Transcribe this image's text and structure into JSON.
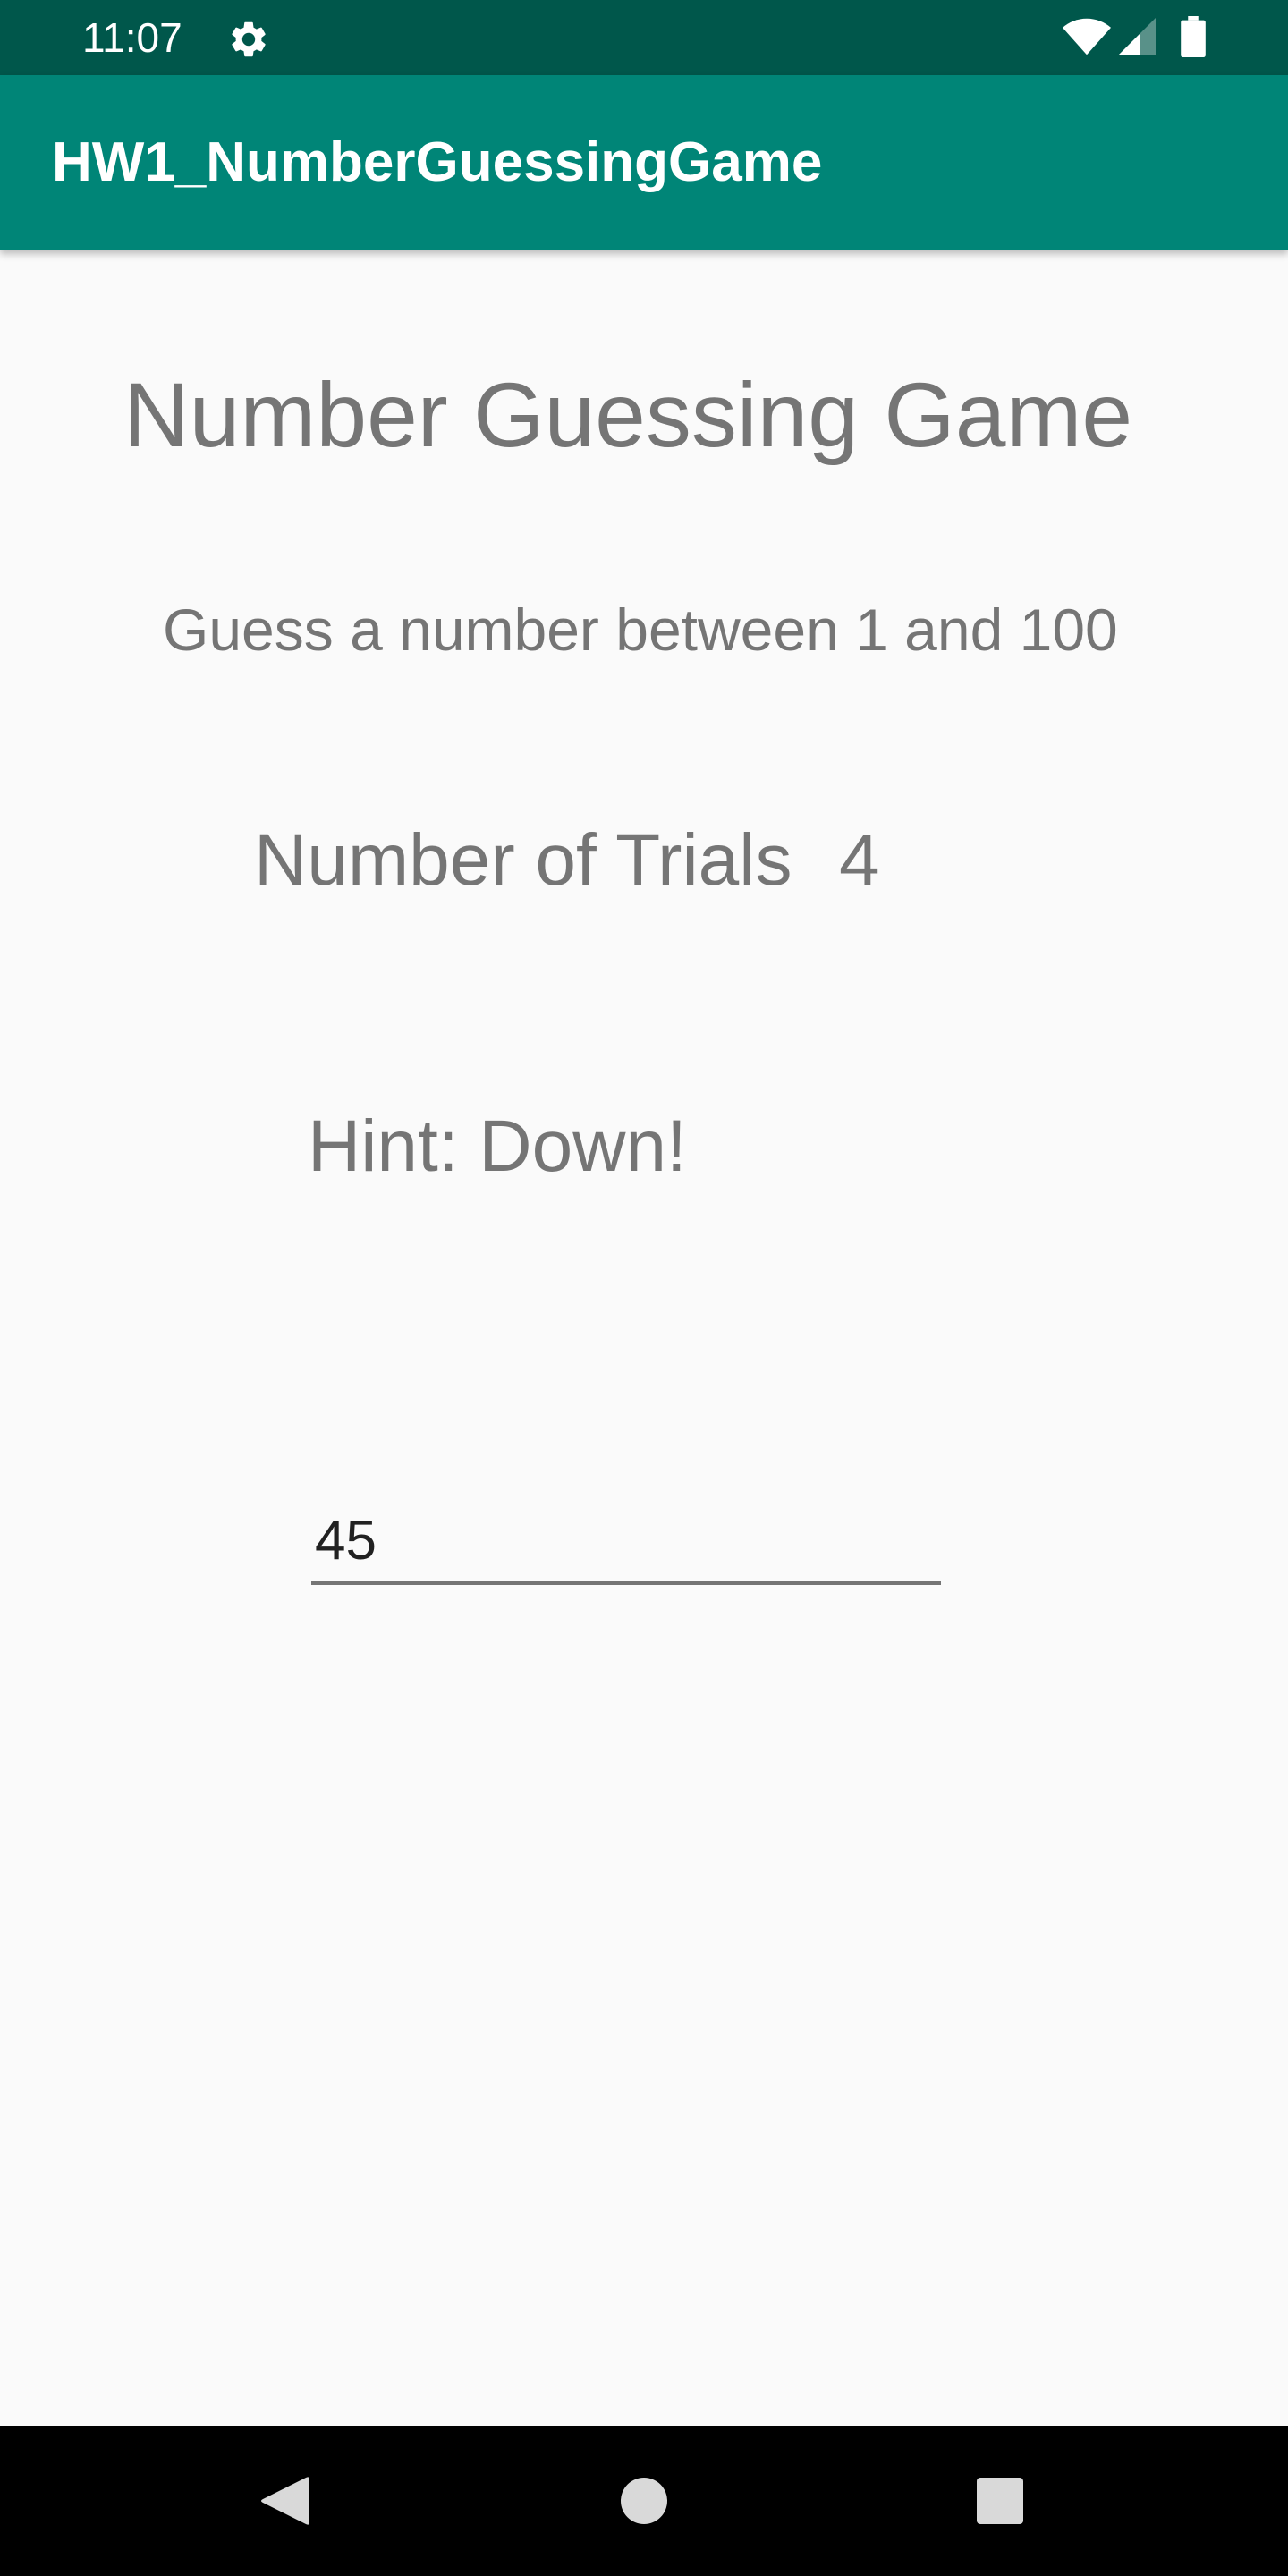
{
  "status_bar": {
    "time": "11:07",
    "icons": [
      "gear-icon",
      "wifi-icon",
      "signal-icon",
      "battery-icon"
    ],
    "background": "#00574b"
  },
  "app_bar": {
    "title": "HW1_NumberGuessingGame",
    "background": "#008577"
  },
  "main": {
    "game_title": "Number Guessing Game",
    "instruction": "Guess a number between 1 and 100",
    "trials_label": "Number of Trials",
    "trials_value": "4",
    "hint": "Hint: Down!",
    "guess_input_value": "45"
  },
  "nav_bar": {
    "icons": [
      "back-icon",
      "home-icon",
      "recents-icon"
    ]
  }
}
